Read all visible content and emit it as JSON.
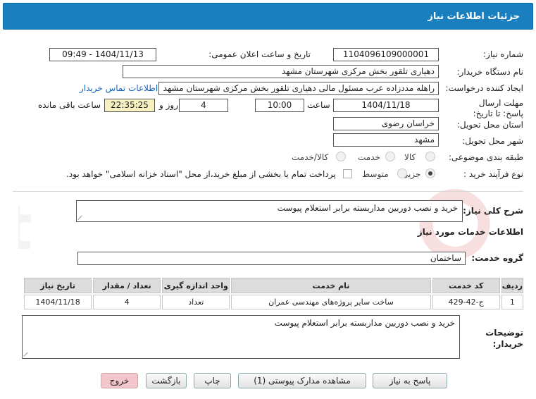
{
  "title": "جزئیات اطلاعات نیاز",
  "need_number": {
    "label": "شماره نیاز:",
    "value": "1104096109000001"
  },
  "announce": {
    "label": "تاریخ و ساعت اعلان عمومی:",
    "value": "1404/11/13 - 09:49"
  },
  "buyer": {
    "label": "نام دستگاه خریدار:",
    "value": "دهیاری تلقور بخش مرکزی شهرستان مشهد"
  },
  "creator": {
    "label": "ایجاد کننده درخواست:",
    "value": "راهله مددزاده عرب مسئول مالی  دهیاری تلقور بخش مرکزی شهرستان مشهد",
    "contact_link": "اطلاعات تماس خریدار"
  },
  "deadline": {
    "label": "مهلت ارسال پاسخ: تا تاریخ:",
    "date": "1404/11/18",
    "time_label": "ساعت",
    "time": "10:00",
    "days": "4",
    "days_label": "روز و",
    "remaining": "22:35:25",
    "remaining_label": "ساعت باقی مانده"
  },
  "province": {
    "label": "استان محل تحویل:",
    "value": "خراسان رضوی"
  },
  "city": {
    "label": "شهر محل تحویل:",
    "value": "مشهد"
  },
  "category": {
    "label": "طبقه بندی موضوعی:",
    "options": [
      "کالا",
      "خدمت",
      "کالا/خدمت"
    ],
    "selected": "خدمت"
  },
  "process": {
    "label": "نوع فرآیند خرید :",
    "options": [
      "جزیی",
      "متوسط"
    ],
    "selected": "جزیی",
    "treasury_text": "پرداخت تمام یا بخشی از مبلغ خرید،از محل \"اسناد خزانه اسلامی\" خواهد بود."
  },
  "general_desc": {
    "label": "شرح کلی نیاز:",
    "value": "خرید و نصب دوربین مداربسته برابر استعلام پیوست"
  },
  "services_title": "اطلاعات خدمات مورد نیاز",
  "service_group": {
    "label": "گروه خدمت:",
    "value": "ساختمان"
  },
  "table": {
    "headers": [
      "ردیف",
      "کد خدمت",
      "نام خدمت",
      "واحد اندازه گیری",
      "تعداد / مقدار",
      "تاریخ نیاز"
    ],
    "rows": [
      [
        "1",
        "ج-42-429",
        "ساخت سایر پروژه‌های مهندسی عمران",
        "تعداد",
        "4",
        "1404/11/18"
      ]
    ]
  },
  "buyer_notes": {
    "label": "توضیحات خریدار:",
    "value": "خرید و نصب دوربین مداربسته برابر استعلام پیوست"
  },
  "buttons": {
    "reply": "پاسخ به نیاز",
    "attachments": "مشاهده مدارک پیوستی (1)",
    "print": "چاپ",
    "back": "بازگشت",
    "exit": "خروج"
  },
  "watermark": "AriaTender.net",
  "colors": {
    "header": "#1a7fbe",
    "link": "#1565c0",
    "remaining_bg": "#f6f0c2",
    "exit_bg": "#f3c6cb"
  }
}
